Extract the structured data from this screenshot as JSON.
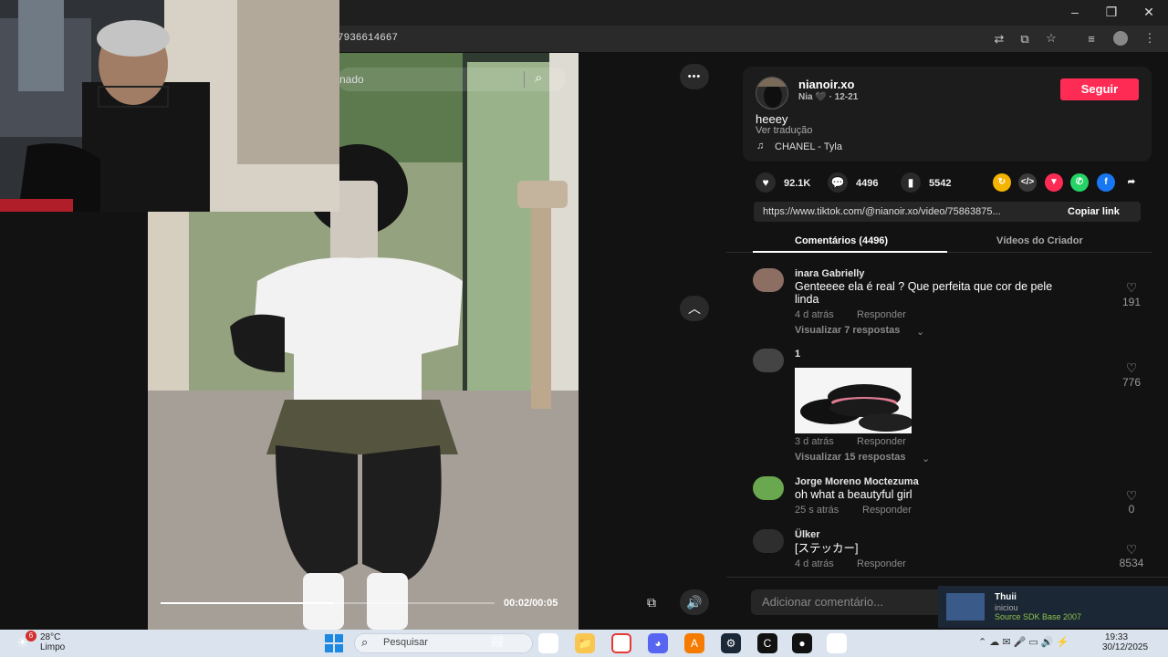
{
  "browser": {
    "url": "7936614667",
    "translate_icon": "translate-icon",
    "install_icon": "install-app-icon",
    "star_icon": "bookmark-star-icon",
    "media_icon": "media-control-icon",
    "menu_icon": "kebab-menu-icon",
    "window_controls": [
      "–",
      "❐",
      "✕"
    ]
  },
  "video": {
    "search_placeholder": "nado",
    "time": "00:02/00:05",
    "progress": 0.52,
    "more_button": "•••"
  },
  "creator": {
    "username": "nianoir.xo",
    "display_sub": "Nia 🖤 · 12-21",
    "follow_label": "Seguir",
    "caption": "heeey",
    "translate_label": "Ver tradução",
    "music": "CHANEL - Tyla"
  },
  "stats": {
    "likes": "92.1K",
    "comments": "4496",
    "saves": "5542"
  },
  "share": {
    "link": "https://www.tiktok.com/@nianoir.xo/video/75863875...",
    "copy_label": "Copiar link"
  },
  "tabs": {
    "comments": "Comentários (4496)",
    "creator_videos": "Vídeos do Criador"
  },
  "comments": [
    {
      "name": "inara Gabrielly",
      "text_line1": "Genteeee ela é real ? Que perfeita que cor de pele",
      "text_line2": "linda",
      "time": "4 d atrás",
      "reply": "Responder",
      "replies": "Visualizar 7 respostas",
      "likes": "191"
    },
    {
      "name": "1",
      "time": "3 d atrás",
      "reply": "Responder",
      "replies": "Visualizar 15 respostas",
      "likes": "776"
    },
    {
      "name": "Jorge Moreno Moctezuma",
      "text_line1": "oh what a beautyful girl",
      "time": "25 s atrás",
      "reply": "Responder",
      "likes": "0"
    },
    {
      "name": "Ülker",
      "text_line1": "[ステッカー]",
      "time": "4 d atrás",
      "reply": "Responder",
      "likes": "8534"
    }
  ],
  "comment_input": {
    "placeholder": "Adicionar comentário..."
  },
  "notification": {
    "name": "Thuii",
    "status": "iniciou",
    "game": "Source SDK Base 2007"
  },
  "taskbar": {
    "weather_temp": "28°C",
    "weather_desc": "Limpo",
    "weather_badge": "6",
    "search_label": "Pesquisar",
    "time": "19:33",
    "date": "30/12/2025"
  },
  "colors": {
    "accent": "#fe2c55",
    "panel_bg": "#121212",
    "card_bg": "#1c1c1c"
  }
}
